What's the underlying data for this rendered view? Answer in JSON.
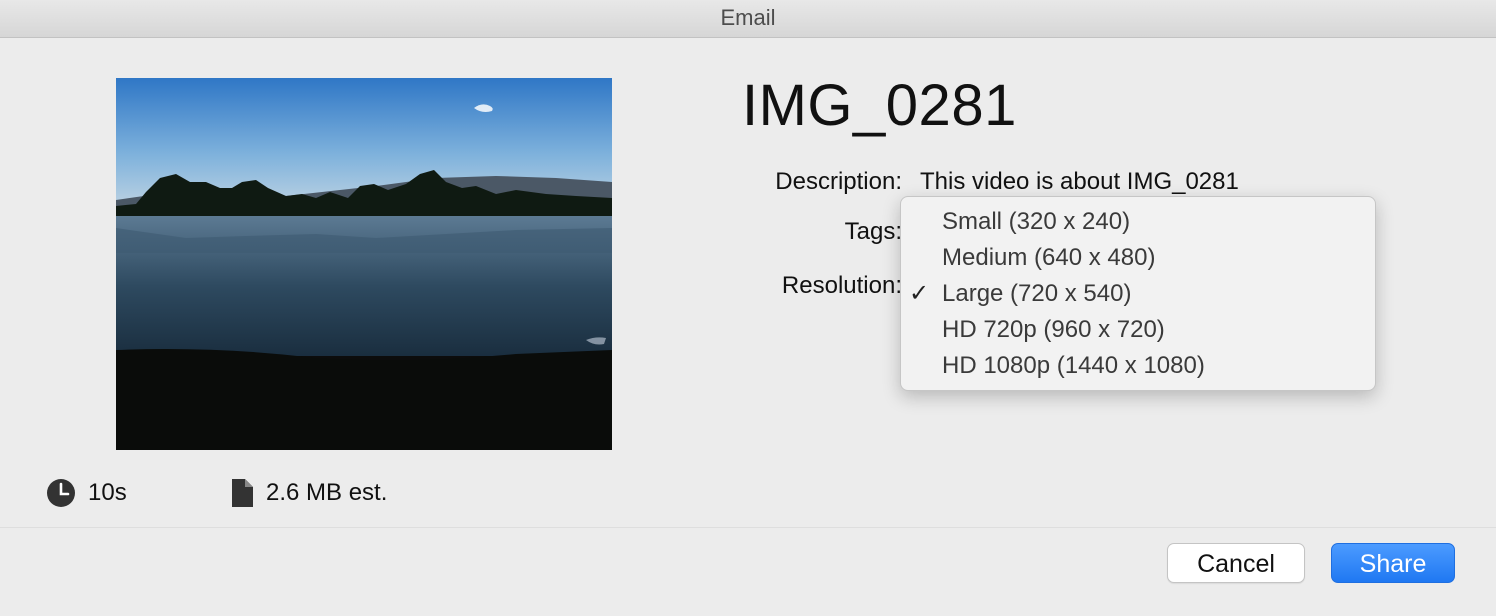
{
  "window": {
    "title": "Email"
  },
  "preview": {
    "duration": "10s",
    "size": "2.6 MB est.",
    "duration_icon": "clock-icon",
    "size_icon": "document-icon"
  },
  "video": {
    "title": "IMG_0281"
  },
  "form": {
    "description_label": "Description:",
    "description_value": "This video is about IMG_0281",
    "tags_label": "Tags:",
    "resolution_label": "Resolution:"
  },
  "resolution_menu": {
    "selected_index": 2,
    "options": [
      {
        "label": "Small (320 x 240)",
        "checked": false
      },
      {
        "label": "Medium (640 x 480)",
        "checked": false
      },
      {
        "label": "Large (720 x 540)",
        "checked": true
      },
      {
        "label": "HD 720p (960 x 720)",
        "checked": false
      },
      {
        "label": "HD 1080p (1440 x 1080)",
        "checked": false
      }
    ]
  },
  "actions": {
    "cancel": "Cancel",
    "share": "Share"
  },
  "colors": {
    "accent": "#1f78f2",
    "background": "#ececec"
  }
}
